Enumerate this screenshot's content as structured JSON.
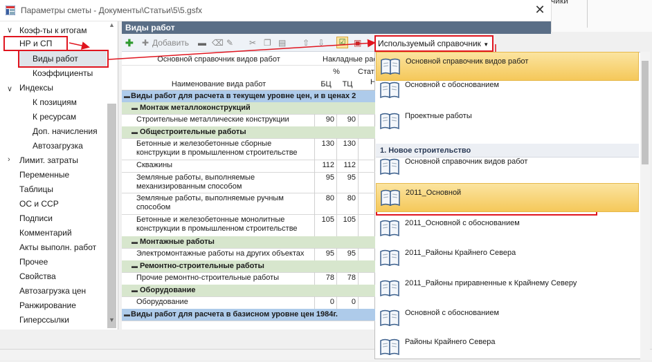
{
  "window": {
    "title": "Параметры сметы - Документы\\Статьи\\5\\5.gsfx",
    "close": "✕",
    "bg_app_text": "чики"
  },
  "tree": {
    "items": [
      {
        "label": "Коэф-ты к итогам"
      },
      {
        "label": "НР и СП"
      },
      {
        "label": "Виды работ"
      },
      {
        "label": "Коэффициенты"
      },
      {
        "label": "Индексы"
      },
      {
        "label": "К позициям"
      },
      {
        "label": "К ресурсам"
      },
      {
        "label": "Доп. начисления"
      },
      {
        "label": "Автозагрузка"
      },
      {
        "label": "Лимит. затраты"
      },
      {
        "label": "Переменные"
      },
      {
        "label": "Таблицы"
      },
      {
        "label": "ОС и ССР"
      },
      {
        "label": "Подписи"
      },
      {
        "label": "Комментарий"
      },
      {
        "label": "Акты выполн. работ"
      },
      {
        "label": "Прочее"
      },
      {
        "label": "Свойства"
      },
      {
        "label": "Автозагрузка цен"
      },
      {
        "label": "Ранжирование"
      },
      {
        "label": "Гиперссылки"
      }
    ]
  },
  "panel": {
    "title": "Виды работ",
    "add_label": "Добавить"
  },
  "grid": {
    "header_ref": "Основной справочник видов работ",
    "header_overhead": "Накладные рас",
    "header_percent": "%",
    "header_stat": "Стат",
    "header_stat2": "Н",
    "header_name": "Наименование вида работ",
    "header_bc": "БЦ",
    "header_tc": "ТЦ",
    "rows": [
      {
        "kind": "group1",
        "name": "Виды работ для расчета в текущем уровне цен, и в ценах 2"
      },
      {
        "kind": "group2",
        "name": "Монтаж металлоконструкций"
      },
      {
        "kind": "row",
        "name": "Строительные металлические конструкции",
        "bc": "90",
        "tc": "90"
      },
      {
        "kind": "group2",
        "name": "Общестроительные работы"
      },
      {
        "kind": "row",
        "name": "Бетонные и железобетонные сборные конструкции в промышленном строительстве",
        "bc": "130",
        "tc": "130"
      },
      {
        "kind": "row",
        "name": "Скважины",
        "bc": "112",
        "tc": "112"
      },
      {
        "kind": "row",
        "name": "Земляные работы, выполняемые механизированным способом",
        "bc": "95",
        "tc": "95"
      },
      {
        "kind": "row",
        "name": "Земляные работы, выполняемые ручным способом",
        "bc": "80",
        "tc": "80"
      },
      {
        "kind": "row",
        "name": "Бетонные и железобетонные монолитные конструкции в промышленном строительстве",
        "bc": "105",
        "tc": "105"
      },
      {
        "kind": "group2",
        "name": "Монтажные работы"
      },
      {
        "kind": "row",
        "name": "Электромонтажные работы на других объектах",
        "bc": "95",
        "tc": "95"
      },
      {
        "kind": "group2",
        "name": "Ремонтно-строительные работы"
      },
      {
        "kind": "row",
        "name": "Прочие ремонтно-строительные работы",
        "bc": "78",
        "tc": "78"
      },
      {
        "kind": "group2",
        "name": "Оборудование"
      },
      {
        "kind": "row",
        "name": "Оборудование",
        "bc": "0",
        "tc": "0"
      },
      {
        "kind": "group1",
        "name": "Виды работ для расчета в базисном уровне цен 1984г."
      }
    ]
  },
  "dropdown": {
    "button_label": "Используемый справочник",
    "group_label": "1. Новое строительство",
    "items": [
      {
        "label": "Основной справочник видов работ"
      },
      {
        "label": "Основной с обоснованием"
      },
      {
        "label": "Проектные работы"
      },
      {
        "label": "Основной справочник видов работ"
      },
      {
        "label": "2011_Основной"
      },
      {
        "label": "2011_Основной с обоснованием"
      },
      {
        "label": "2011_Районы Крайнего Севера"
      },
      {
        "label": "2011_Районы приравненные к Крайнему Северу"
      },
      {
        "label": "Основной с обоснованием"
      },
      {
        "label": "Районы Крайнего Севера"
      }
    ]
  },
  "colors": {
    "accent_red": "#e0141e",
    "panel_header": "#5a6e86",
    "selected_item": "#f5c85a",
    "group_row": "#aecbea"
  }
}
